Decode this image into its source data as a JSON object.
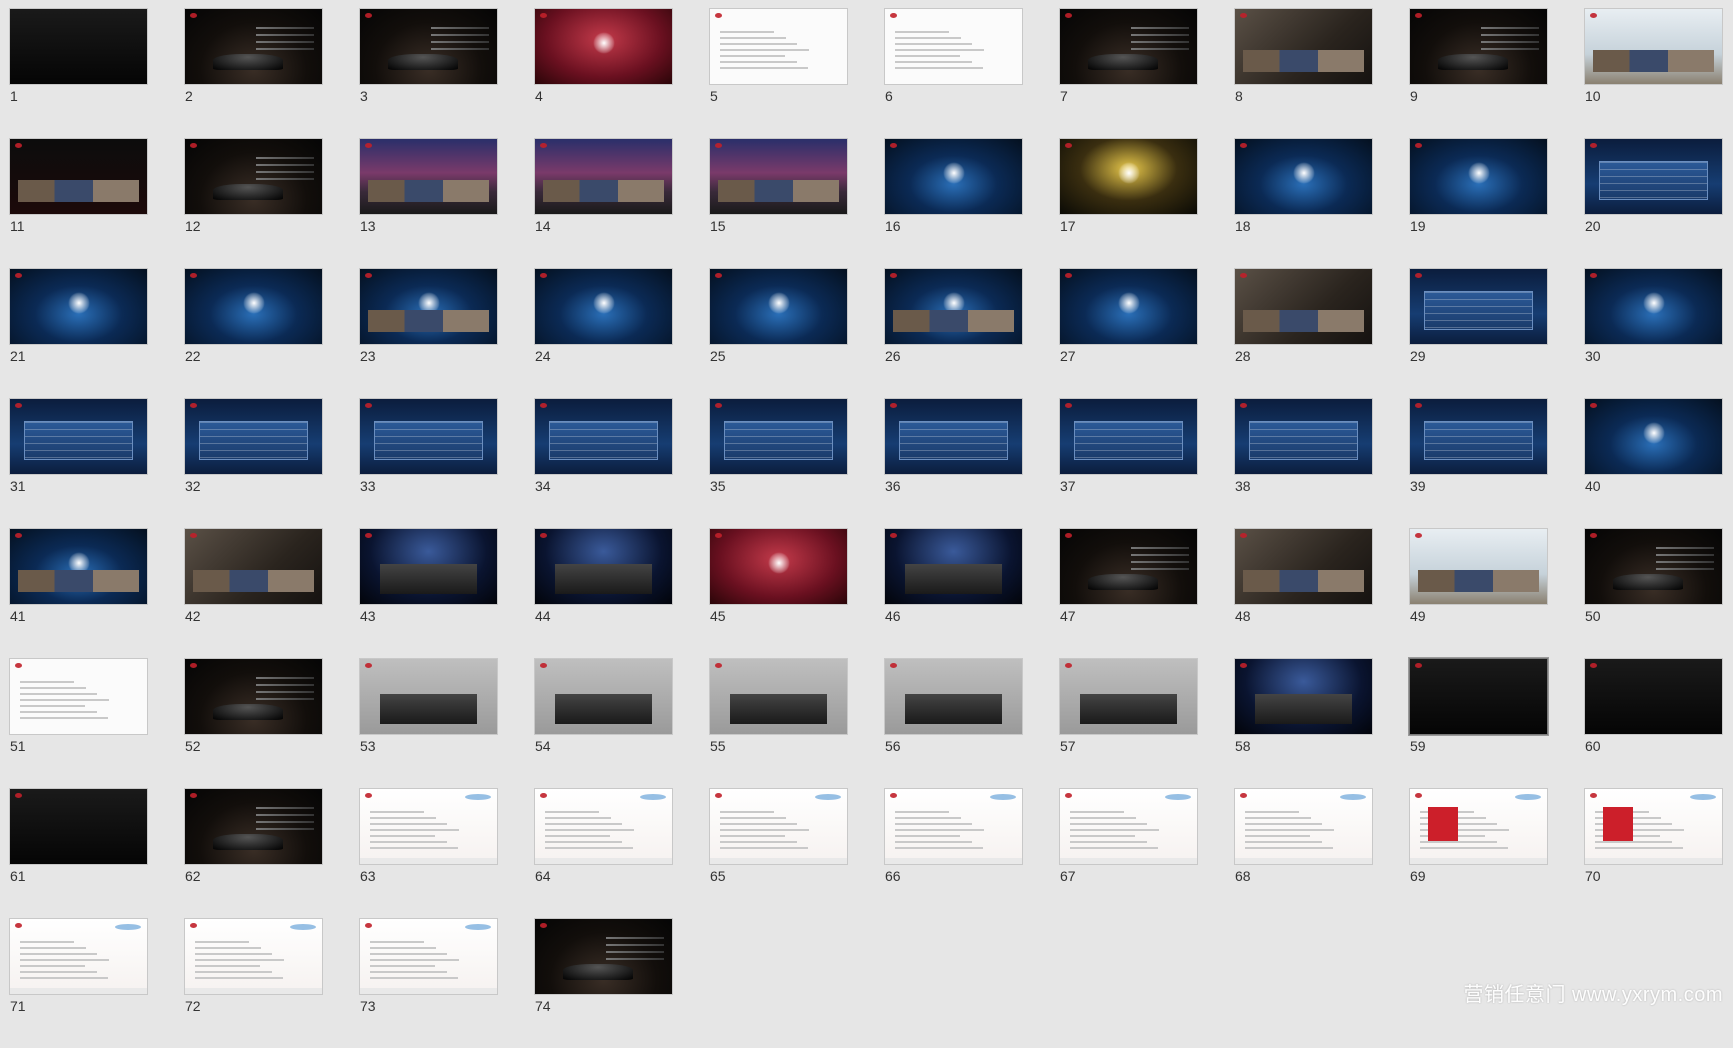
{
  "slides": [
    {
      "number": "1",
      "theme": "t-black"
    },
    {
      "number": "2",
      "theme": "t-car"
    },
    {
      "number": "3",
      "theme": "t-car"
    },
    {
      "number": "4",
      "theme": "t-red"
    },
    {
      "number": "5",
      "theme": "t-white"
    },
    {
      "number": "6",
      "theme": "t-white"
    },
    {
      "number": "7",
      "theme": "t-car"
    },
    {
      "number": "8",
      "theme": "t-photo"
    },
    {
      "number": "9",
      "theme": "t-car"
    },
    {
      "number": "10",
      "theme": "t-sky"
    },
    {
      "number": "11",
      "theme": "t-dark-red"
    },
    {
      "number": "12",
      "theme": "t-car"
    },
    {
      "number": "13",
      "theme": "t-city"
    },
    {
      "number": "14",
      "theme": "t-city"
    },
    {
      "number": "15",
      "theme": "t-city"
    },
    {
      "number": "16",
      "theme": "t-blue"
    },
    {
      "number": "17",
      "theme": "t-gold"
    },
    {
      "number": "18",
      "theme": "t-blue"
    },
    {
      "number": "19",
      "theme": "t-blue"
    },
    {
      "number": "20",
      "theme": "t-bluetable"
    },
    {
      "number": "21",
      "theme": "t-blue"
    },
    {
      "number": "22",
      "theme": "t-blue"
    },
    {
      "number": "23",
      "theme": "t-blue"
    },
    {
      "number": "24",
      "theme": "t-blue"
    },
    {
      "number": "25",
      "theme": "t-blue"
    },
    {
      "number": "26",
      "theme": "t-blue"
    },
    {
      "number": "27",
      "theme": "t-blue"
    },
    {
      "number": "28",
      "theme": "t-photo"
    },
    {
      "number": "29",
      "theme": "t-bluetable"
    },
    {
      "number": "30",
      "theme": "t-blue"
    },
    {
      "number": "31",
      "theme": "t-bluetable"
    },
    {
      "number": "32",
      "theme": "t-bluetable"
    },
    {
      "number": "33",
      "theme": "t-bluetable"
    },
    {
      "number": "34",
      "theme": "t-bluetable"
    },
    {
      "number": "35",
      "theme": "t-bluetable"
    },
    {
      "number": "36",
      "theme": "t-bluetable"
    },
    {
      "number": "37",
      "theme": "t-bluetable"
    },
    {
      "number": "38",
      "theme": "t-bluetable"
    },
    {
      "number": "39",
      "theme": "t-bluetable"
    },
    {
      "number": "40",
      "theme": "t-blue"
    },
    {
      "number": "41",
      "theme": "t-blue"
    },
    {
      "number": "42",
      "theme": "t-photo"
    },
    {
      "number": "43",
      "theme": "t-stage"
    },
    {
      "number": "44",
      "theme": "t-stage"
    },
    {
      "number": "45",
      "theme": "t-red"
    },
    {
      "number": "46",
      "theme": "t-stage"
    },
    {
      "number": "47",
      "theme": "t-car"
    },
    {
      "number": "48",
      "theme": "t-photo"
    },
    {
      "number": "49",
      "theme": "t-sky"
    },
    {
      "number": "50",
      "theme": "t-car"
    },
    {
      "number": "51",
      "theme": "t-white"
    },
    {
      "number": "52",
      "theme": "t-car"
    },
    {
      "number": "53",
      "theme": "t-gray"
    },
    {
      "number": "54",
      "theme": "t-gray"
    },
    {
      "number": "55",
      "theme": "t-gray"
    },
    {
      "number": "56",
      "theme": "t-gray"
    },
    {
      "number": "57",
      "theme": "t-gray"
    },
    {
      "number": "58",
      "theme": "t-stage"
    },
    {
      "number": "59",
      "theme": "t-black",
      "selected": true
    },
    {
      "number": "60",
      "theme": "t-black"
    },
    {
      "number": "61",
      "theme": "t-black"
    },
    {
      "number": "62",
      "theme": "t-car"
    },
    {
      "number": "63",
      "theme": "t-doc"
    },
    {
      "number": "64",
      "theme": "t-doc"
    },
    {
      "number": "65",
      "theme": "t-doc"
    },
    {
      "number": "66",
      "theme": "t-doc"
    },
    {
      "number": "67",
      "theme": "t-doc"
    },
    {
      "number": "68",
      "theme": "t-doc"
    },
    {
      "number": "69",
      "theme": "t-doc"
    },
    {
      "number": "70",
      "theme": "t-doc"
    },
    {
      "number": "71",
      "theme": "t-doc"
    },
    {
      "number": "72",
      "theme": "t-doc"
    },
    {
      "number": "73",
      "theme": "t-doc"
    },
    {
      "number": "74",
      "theme": "t-car"
    }
  ],
  "watermark": "营销任意门 www.yxrym.com",
  "colors": {
    "background": "#e6e6e6",
    "brand_red": "#c0202a",
    "selection_border": "#7a7a7a"
  }
}
